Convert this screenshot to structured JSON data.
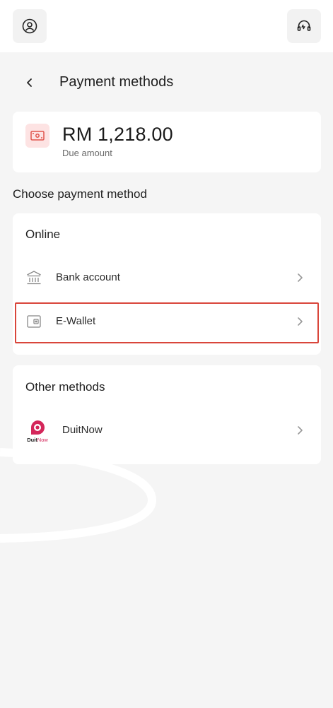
{
  "header": {
    "title": "Payment methods"
  },
  "amount": {
    "value": "RM 1,218.00",
    "label": "Due amount"
  },
  "section_label": "Choose payment method",
  "online": {
    "title": "Online",
    "items": [
      {
        "label": "Bank account",
        "icon": "bank-icon"
      },
      {
        "label": "E-Wallet",
        "icon": "wallet-icon"
      }
    ]
  },
  "other": {
    "title": "Other methods",
    "items": [
      {
        "label": "DuitNow",
        "icon": "duitnow-logo",
        "logo_text": "DuitNow"
      }
    ]
  },
  "colors": {
    "accent": "#d9463b",
    "icon_bg": "#fde3e3",
    "logo": "#d4265a"
  }
}
